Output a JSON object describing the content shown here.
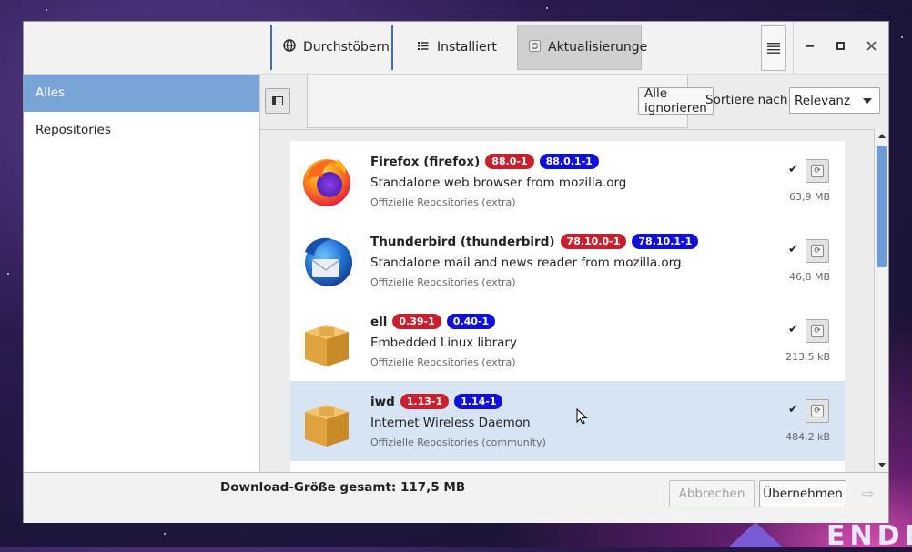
{
  "tabs": [
    {
      "icon": "globe-icon",
      "label": "Durchstöbern"
    },
    {
      "icon": "list-icon",
      "label": "Installiert"
    },
    {
      "icon": "refresh-icon",
      "label": "Aktualisierunge"
    }
  ],
  "sidebar": {
    "items": [
      {
        "label": "Alles",
        "active": true
      },
      {
        "label": "Repositories",
        "active": false
      }
    ]
  },
  "toolbar": {
    "ignore_all": "Alle ignorieren",
    "sort_label": "Sortiere nach",
    "sort_value": "Relevanz"
  },
  "packages": [
    {
      "icon": "firefox-icon",
      "name": "Firefox (firefox)",
      "old_version": "88.0-1",
      "new_version": "88.0.1-1",
      "description": "Standalone web browser from mozilla.org",
      "repo": "Offizielle Repositories (extra)",
      "size": "63,9 MB"
    },
    {
      "icon": "thunderbird-icon",
      "name": "Thunderbird (thunderbird)",
      "old_version": "78.10.0-1",
      "new_version": "78.10.1-1",
      "description": "Standalone mail and news reader from mozilla.org",
      "repo": "Offizielle Repositories (extra)",
      "size": "46,8 MB"
    },
    {
      "icon": "package-box-icon",
      "name": "ell",
      "old_version": "0.39-1",
      "new_version": "0.40-1",
      "description": "Embedded Linux library",
      "repo": "Offizielle Repositories (extra)",
      "size": "213,5 kB"
    },
    {
      "icon": "package-box-icon",
      "name": "iwd",
      "old_version": "1.13-1",
      "new_version": "1.14-1",
      "description": "Internet Wireless Daemon",
      "repo": "Offizielle Repositories (community)",
      "size": "484,2 kB"
    }
  ],
  "footer": {
    "download_size": "Download-Größe gesamt: 117,5 MB",
    "cancel": "Abbrechen",
    "apply": "Übernehmen"
  },
  "desktop": {
    "logo_text": "ENDEA"
  },
  "colors": {
    "selection": "#79a4d8",
    "old_badge": "#c8202f",
    "new_badge": "#1010d8"
  }
}
